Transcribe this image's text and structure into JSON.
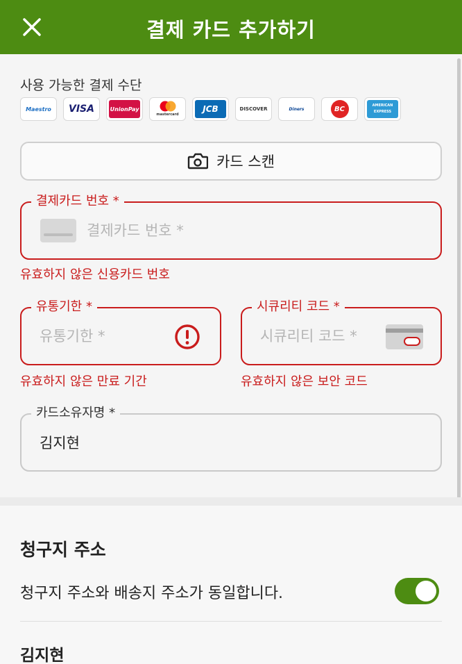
{
  "header": {
    "title": "결제 카드 추가하기",
    "close_icon": "close-icon"
  },
  "payment_methods": {
    "label": "사용 가능한 결제 수단",
    "logos": [
      {
        "name": "maestro-logo",
        "text": "Maestro",
        "color": "#1d6fc4",
        "bg": "#ffffff"
      },
      {
        "name": "visa-logo",
        "text": "VISA",
        "color": "#1a1f71",
        "bg": "#ffffff"
      },
      {
        "name": "unionpay-logo",
        "text": "UnionPay",
        "color": "#ffffff",
        "bg": "#d31145"
      },
      {
        "name": "mastercard-logo",
        "text": "mastercard",
        "color": "#333333",
        "bg": "#ffffff"
      },
      {
        "name": "jcb-logo",
        "text": "JCB",
        "color": "#ffffff",
        "bg": "#0b6bb5"
      },
      {
        "name": "discover-logo",
        "text": "DISCOVER",
        "color": "#333333",
        "bg": "#ffffff"
      },
      {
        "name": "diners-logo",
        "text": "Diners",
        "color": "#0a4595",
        "bg": "#ffffff"
      },
      {
        "name": "bc-logo",
        "text": "BC",
        "color": "#ffffff",
        "bg": "#e02424"
      },
      {
        "name": "amex-logo",
        "text": "AMERICAN EXPRESS",
        "color": "#ffffff",
        "bg": "#2e9bd6"
      }
    ]
  },
  "scan_button": {
    "label": "카드 스캔",
    "icon": "camera-icon"
  },
  "card_number": {
    "label": "결제카드 번호 *",
    "placeholder": "결제카드 번호 *",
    "value": "",
    "error": "유효하지 않은 신용카드 번호",
    "icon": "credit-card-icon"
  },
  "expiry": {
    "label": "유통기한 *",
    "placeholder": "유통기한 *",
    "value": "",
    "error": "유효하지 않은 만료 기간",
    "icon": "error-icon"
  },
  "security_code": {
    "label": "시큐리티 코드 *",
    "placeholder": "시큐리티 코드 *",
    "value": "",
    "error": "유효하지 않은 보안 코드",
    "icon": "cvv-card-icon"
  },
  "card_holder": {
    "label": "카드소유자명 *",
    "value": "김지현"
  },
  "billing": {
    "title": "청구지 주소",
    "same_as_shipping_label": "청구지 주소와 배송지 주소가 동일합니다.",
    "same_as_shipping": true,
    "name": "김지현"
  },
  "colors": {
    "brand": "#4d8c12",
    "error": "#c91c1c"
  }
}
